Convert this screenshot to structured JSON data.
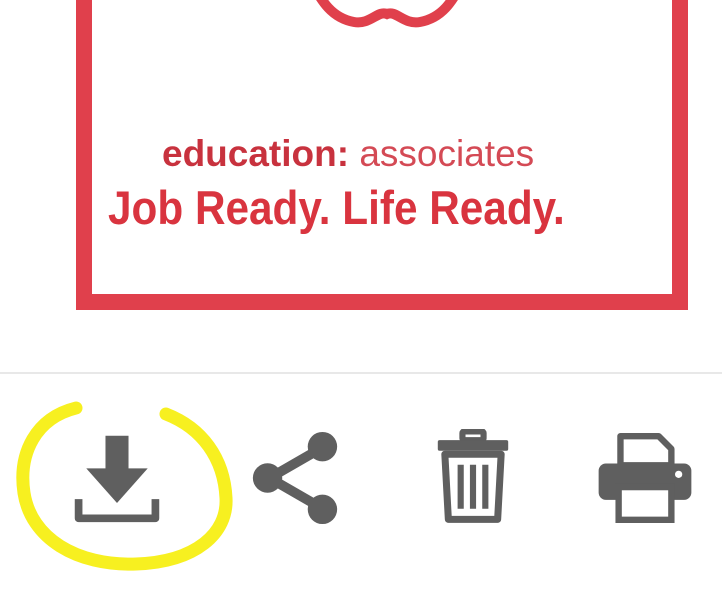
{
  "brand": {
    "name_bold": "education:",
    "name_light": " associates",
    "tagline": "Job Ready. Life Ready.",
    "colors": {
      "primary": "#e0404c",
      "text": "#c8323e"
    }
  },
  "toolbar": {
    "buttons": [
      {
        "id": "download",
        "icon": "download-icon",
        "highlighted": true
      },
      {
        "id": "share",
        "icon": "share-icon",
        "highlighted": false
      },
      {
        "id": "delete",
        "icon": "trash-icon",
        "highlighted": false
      },
      {
        "id": "print",
        "icon": "printer-icon",
        "highlighted": false
      }
    ],
    "icon_color": "#5f5f5f",
    "highlight_color": "#f7f020"
  }
}
